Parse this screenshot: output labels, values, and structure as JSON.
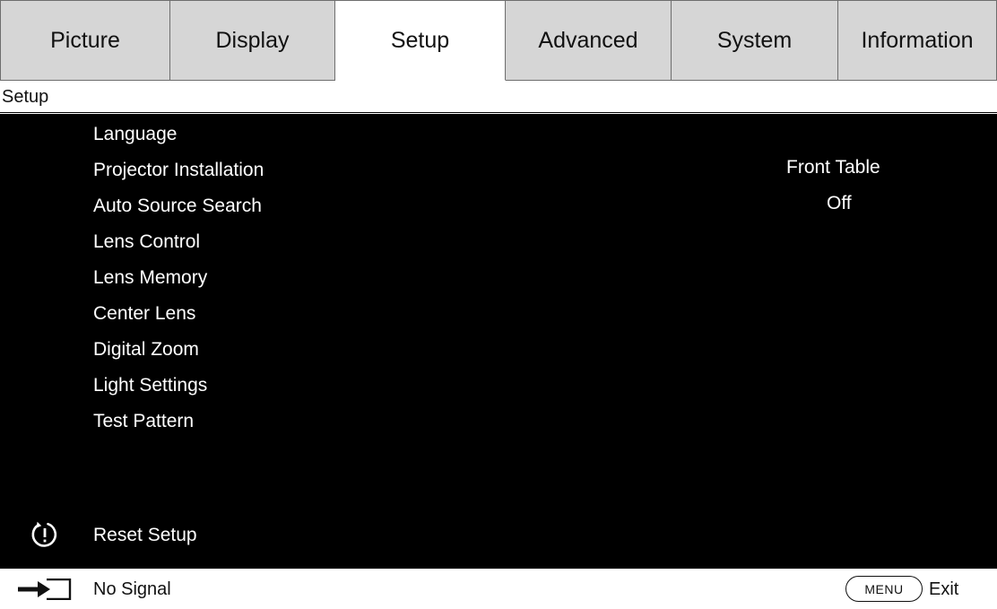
{
  "tabs": [
    {
      "label": "Picture"
    },
    {
      "label": "Display"
    },
    {
      "label": "Setup"
    },
    {
      "label": "Advanced"
    },
    {
      "label": "System"
    },
    {
      "label": "Information"
    }
  ],
  "active_tab": "Setup",
  "breadcrumb": "Setup",
  "menu": {
    "items": [
      {
        "label": "Language"
      },
      {
        "label": "Projector Installation"
      },
      {
        "label": "Auto Source Search"
      },
      {
        "label": "Lens Control"
      },
      {
        "label": "Lens Memory"
      },
      {
        "label": "Center Lens"
      },
      {
        "label": "Digital Zoom"
      },
      {
        "label": "Light Settings"
      },
      {
        "label": "Test Pattern"
      }
    ],
    "values": {
      "projector_installation": "Front Table",
      "auto_source_search": "Off"
    },
    "reset": {
      "label": "Reset Setup",
      "icon": "reset-icon"
    }
  },
  "status": {
    "source_icon": "input-source-icon",
    "signal": "No Signal",
    "menu_button": "MENU",
    "exit": "Exit"
  },
  "colors": {
    "panel_bg": "#000000",
    "tab_inactive": "#d6d6d6",
    "tab_active": "#ffffff",
    "text_on_panel": "#ffffff"
  }
}
